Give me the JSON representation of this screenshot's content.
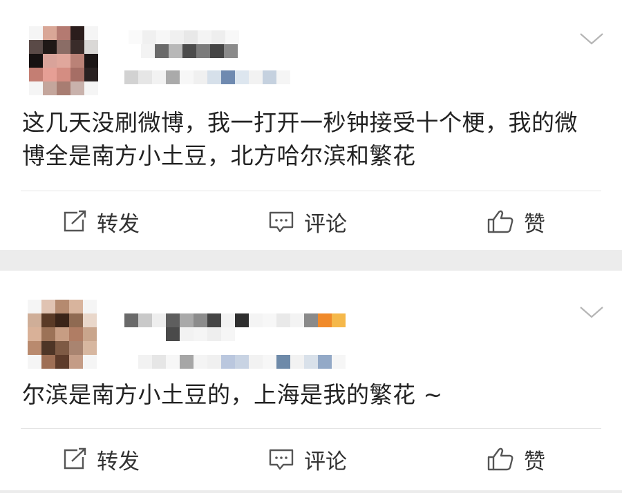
{
  "colors": {
    "separator": "#ececec",
    "text": "#222222",
    "icon": "#555555"
  },
  "posts": [
    {
      "avatar_pixels": [
        [
          "#f5f5f5",
          "#d9a797",
          "#b47a71",
          "#2b1d1c",
          "#f5f5f5"
        ],
        [
          "#5a4a47",
          "#1f1816",
          "#8b6d66",
          "#3a2c2a",
          "#dad8d6"
        ],
        [
          "#161111",
          "#d9a39a",
          "#e0a79c",
          "#ba8277",
          "#1c1616"
        ],
        [
          "#c47e73",
          "#e69f95",
          "#d48d82",
          "#a66e65",
          "#2a2222"
        ],
        [
          "#f5f5f5",
          "#c4a69c",
          "#a87d72",
          "#c9b2ac",
          "#f5f5f5"
        ]
      ],
      "name_pixels": [
        "#fafafa",
        "#f0f0f0",
        "#f7f7f7",
        "#f0f0f0",
        "#e8e8e8",
        "#f4f4f4",
        "#eeeeee",
        "#f8f8f8"
      ],
      "name_pixels_row2": [
        "#f3f3f3",
        "#6a6a6a",
        "#b8b8b8",
        "#4c4c4c",
        "#7b7b7b",
        "#454545",
        "#8a8a8a"
      ],
      "meta_pixels": [
        "#d2d2d2",
        "#e6e6e6",
        "#f2f2f2",
        "#aaaaaa",
        "#f7f7f7",
        "#f0f0f0",
        "#d6e0ea",
        "#6f8ab0",
        "#dde6ef",
        "#f2f2f2",
        "#c5d1df",
        "#f5f5f5"
      ],
      "text": "这几天没刷微博，我一打开一秒钟接受十个梗，我的微博全是南方小土豆，北方哈尔滨和繁花",
      "actions": {
        "repost_label": "转发",
        "comment_label": "评论",
        "like_label": "赞"
      }
    },
    {
      "avatar_pixels": [
        [
          "#f5f5f5",
          "#e0c3b2",
          "#b58a6f",
          "#d8b49d",
          "#f5f5f5"
        ],
        [
          "#cfae98",
          "#5a3a26",
          "#3a2418",
          "#8f6a52",
          "#e9d7ca"
        ],
        [
          "#d9b198",
          "#9c7257",
          "#c79d83",
          "#b07d64",
          "#c9a58c"
        ],
        [
          "#b98a6e",
          "#4e3526",
          "#7e5a44",
          "#a98470",
          "#d7b7a0"
        ],
        [
          "#f5f5f5",
          "#9e6f55",
          "#5d3b2a",
          "#c49c86",
          "#f5f5f5"
        ]
      ],
      "name_pixels": [
        "#6a6a6a",
        "#c9c9c9",
        "#eeeeee",
        "#5e5e5e",
        "#a9a9a9",
        "#8c8c8c",
        "#454545",
        "#f2f2f2",
        "#2f2f2f",
        "#f4f4f4",
        "#f7f7f7",
        "#e9e9e9",
        "#f3f3f3",
        "#8a8a8a",
        "#f08a2a",
        "#f5b84a"
      ],
      "name_pixels_row2": [
        "#4a4a4a",
        "#f2f2f2",
        "#f5f5f5",
        "#eeeeee",
        "#f6f6f6"
      ],
      "meta_pixels": [
        "#f2f2f2",
        "#e6e6e6",
        "#f7f7f7",
        "#a6a6a6",
        "#f4f4f4",
        "#f0f0f0",
        "#bac7de",
        "#c8d3e3",
        "#f2f2f2",
        "#f7f7f7",
        "#6e8aa9",
        "#f2f2f2",
        "#d9e1ea",
        "#93a9c7",
        "#f6f6f6"
      ],
      "text": "尔滨是南方小土豆的，上海是我的繁花 ~",
      "actions": {
        "repost_label": "转发",
        "comment_label": "评论",
        "like_label": "赞"
      }
    }
  ]
}
